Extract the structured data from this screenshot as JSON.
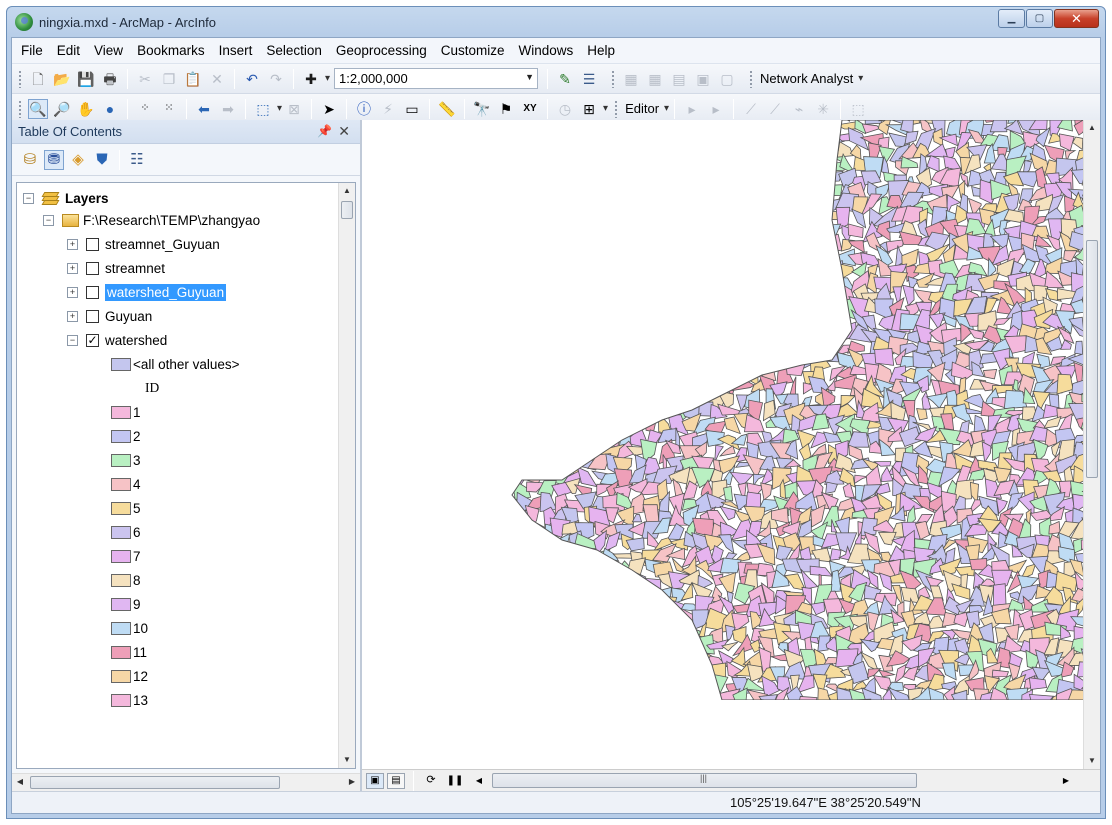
{
  "window": {
    "title": "ningxia.mxd - ArcMap - ArcInfo"
  },
  "menu": [
    "File",
    "Edit",
    "View",
    "Bookmarks",
    "Insert",
    "Selection",
    "Geoprocessing",
    "Customize",
    "Windows",
    "Help"
  ],
  "toolbar": {
    "scale": "1:2,000,000",
    "network_analyst": "Network Analyst",
    "editor": "Editor"
  },
  "toc": {
    "title": "Table Of Contents",
    "root": "Layers",
    "folder": "F:\\Research\\TEMP\\zhangyao",
    "layers": [
      {
        "name": "streamnet_Guyuan",
        "checked": false
      },
      {
        "name": "streamnet",
        "checked": false
      },
      {
        "name": "watershed_Guyuan",
        "checked": false,
        "selected": true
      },
      {
        "name": "Guyuan",
        "checked": false
      },
      {
        "name": "watershed",
        "checked": true
      }
    ],
    "other_values": "<all other values>",
    "field": "ID",
    "classes": [
      {
        "label": "1",
        "color": "#f4b8dc"
      },
      {
        "label": "2",
        "color": "#c3c6f2"
      },
      {
        "label": "3",
        "color": "#b9f0c2"
      },
      {
        "label": "4",
        "color": "#f6c3c6"
      },
      {
        "label": "5",
        "color": "#f6dc9c"
      },
      {
        "label": "6",
        "color": "#cbc4ef"
      },
      {
        "label": "7",
        "color": "#e6b3ef"
      },
      {
        "label": "8",
        "color": "#f5e2bf"
      },
      {
        "label": "9",
        "color": "#e0b7f2"
      },
      {
        "label": "10",
        "color": "#bfdcf4"
      },
      {
        "label": "11",
        "color": "#ee9fb8"
      },
      {
        "label": "12",
        "color": "#f6d7a6"
      },
      {
        "label": "13",
        "color": "#f4b8dc"
      }
    ],
    "all_other_color": "#c4c6ee"
  },
  "status": {
    "coordinates": "105°25'19.647\"E  38°25'20.549\"N"
  }
}
